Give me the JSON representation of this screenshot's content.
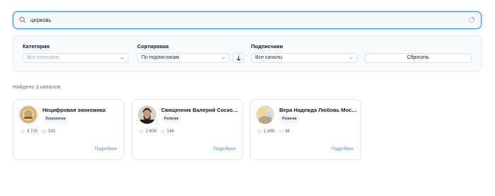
{
  "search": {
    "value": "церковь",
    "placeholder": ""
  },
  "filters": {
    "category": {
      "label": "Категория",
      "placeholder": "Все категории"
    },
    "sort": {
      "label": "Сортировка",
      "value": "По подписчикам"
    },
    "subscribers": {
      "label": "Подписчики",
      "value": "Все каналы"
    },
    "reset_label": "Сбросить"
  },
  "results": {
    "found_text": "Найдено 3 каналов"
  },
  "cards": [
    {
      "title": "Нецифровая экономика",
      "tag": "Технологии",
      "subscribers": "3 720",
      "posts": "333",
      "more": "Подробнее"
    },
    {
      "title": "Священник Валерий Сосковец",
      "tag": "Религия",
      "subscribers": "2 808",
      "posts": "148",
      "more": "Подробнее"
    },
    {
      "title": "Вера Надежда Любовь Москва",
      "tag": "Религия",
      "subscribers": "1 899",
      "posts": "48",
      "more": "Подробнее"
    }
  ],
  "colors": {
    "accent": "#3b8fd9",
    "border": "#e5e9ef",
    "tag_bg": "#f1f3f6"
  },
  "icons": {
    "search": "search-icon",
    "spinner": "loading-spinner-icon",
    "sort": "arrow-down-icon",
    "chevron": "chevron-down-icon"
  }
}
